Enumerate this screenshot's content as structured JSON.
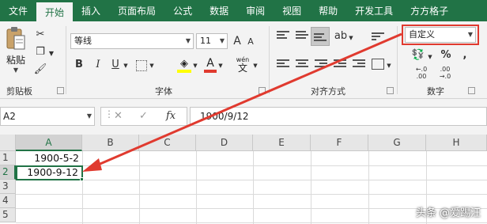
{
  "ribbon": {
    "tabs": [
      "文件",
      "开始",
      "插入",
      "页面布局",
      "公式",
      "数据",
      "审阅",
      "视图",
      "帮助",
      "开发工具",
      "方方格子"
    ],
    "active_tab_index": 1,
    "clipboard": {
      "paste_label": "粘贴",
      "group_label": "剪贴板"
    },
    "font": {
      "font_name": "等线",
      "font_size": "11",
      "bold": "B",
      "italic": "I",
      "underline": "U",
      "grow": "A",
      "shrink": "A",
      "color_letter": "A",
      "wen_label": "wén",
      "wen_char": "文",
      "group_label": "字体"
    },
    "alignment": {
      "group_label": "对齐方式"
    },
    "number": {
      "format_value": "自定义",
      "percent": "%",
      "comma": ",",
      "inc_decimal": "←.0 .00",
      "dec_decimal": ".00 →.0",
      "group_label": "数字"
    }
  },
  "formula_bar": {
    "name_box": "A2",
    "fx_label": "fx",
    "cancel": "✕",
    "enter": "✓",
    "formula": "1900/9/12"
  },
  "sheet": {
    "columns": [
      "A",
      "B",
      "C",
      "D",
      "E",
      "F",
      "G",
      "H"
    ],
    "rows": [
      "1",
      "2",
      "3",
      "4",
      "5"
    ],
    "cells": {
      "A1": "1900-5-2",
      "A2": "1900-9-12"
    },
    "active_cell": "A2"
  },
  "watermark": "头条 @爱踢汪",
  "colors": {
    "accent": "#217346",
    "arrow": "#e03a2f"
  }
}
